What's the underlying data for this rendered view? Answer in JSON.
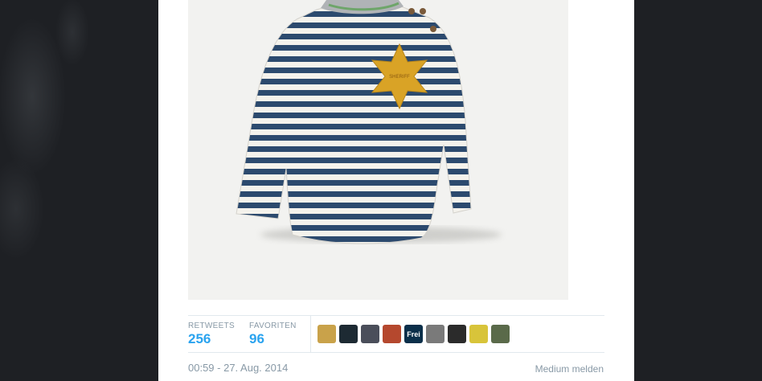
{
  "tweet": {
    "media_alt": "",
    "stats": {
      "retweets_label": "RETWEETS",
      "retweets_count": "256",
      "favorites_label": "FAVORITEN",
      "favorites_count": "96"
    },
    "favoriters": [
      {
        "name": "avatar-1",
        "color": "#c9a24a"
      },
      {
        "name": "avatar-2",
        "color": "#1d2a33"
      },
      {
        "name": "avatar-3",
        "color": "#4a4e5a"
      },
      {
        "name": "avatar-4",
        "color": "#b5482e"
      },
      {
        "name": "avatar-5",
        "color": "#0b2f4a",
        "text": "Frei"
      },
      {
        "name": "avatar-6",
        "color": "#7a7a7a"
      },
      {
        "name": "avatar-7",
        "color": "#2b2b2b"
      },
      {
        "name": "avatar-8",
        "color": "#d8c43a"
      },
      {
        "name": "avatar-9",
        "color": "#5a6a4a"
      }
    ],
    "timestamp": "00:59 - 27. Aug. 2014",
    "report_label": "Medium melden"
  },
  "colors": {
    "accent": "#2aa3ef",
    "muted": "#8899a6",
    "page_bg": "#1e2024",
    "star": "#d9a326",
    "stripe_blue": "#2c4a6e"
  }
}
